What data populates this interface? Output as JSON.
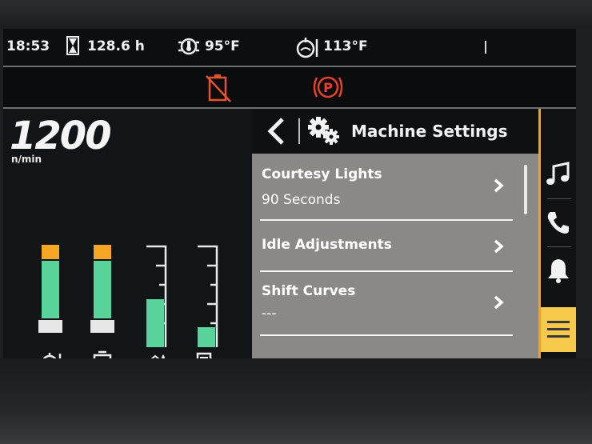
{
  "status_bar": {
    "time": "18:53",
    "engine_hours": "128.6 h",
    "engine_hours_icon": "hourglass-icon",
    "coolant_temp": "95°F",
    "coolant_icon": "engine-coolant-temp-icon",
    "oil_temp": "113°F",
    "oil_icon": "engine-oil-temp-icon"
  },
  "warnings": [
    {
      "icon": "battery-crossed-warning-icon",
      "color": "#e8522a"
    },
    {
      "icon": "parking-brake-warning-icon",
      "color": "#e8402a"
    }
  ],
  "gauges": {
    "rpm_value": "1200",
    "rpm_unit": "n/min",
    "bars": [
      {
        "icon": "engine-temp-gauge-icon",
        "fill": 0.78,
        "warn_fill": 0.08,
        "color": "#58d49a",
        "warn_color": "#f5a623"
      },
      {
        "icon": "transmission-temp-gauge-icon",
        "fill": 0.78,
        "warn_fill": 0.08,
        "color": "#58d49a",
        "warn_color": "#f5a623"
      },
      {
        "icon": "def-level-gauge-icon",
        "fill": 0.48,
        "color": "#58d49a"
      },
      {
        "icon": "fuel-level-gauge-icon",
        "fill": 0.2,
        "color": "#58d49a"
      }
    ]
  },
  "menu": {
    "title": "Machine Settings",
    "title_icon": "gears-icon",
    "items": [
      {
        "label": "Courtesy Lights",
        "value": "90 Seconds"
      },
      {
        "label": "Idle Adjustments",
        "value": ""
      },
      {
        "label": "Shift Curves",
        "value": "---"
      }
    ]
  },
  "rail": {
    "buttons": [
      "music-note-icon",
      "phone-icon",
      "bell-icon",
      "hamburger-menu-icon"
    ],
    "active_index": 3,
    "accent_color": "#f5a01e"
  }
}
